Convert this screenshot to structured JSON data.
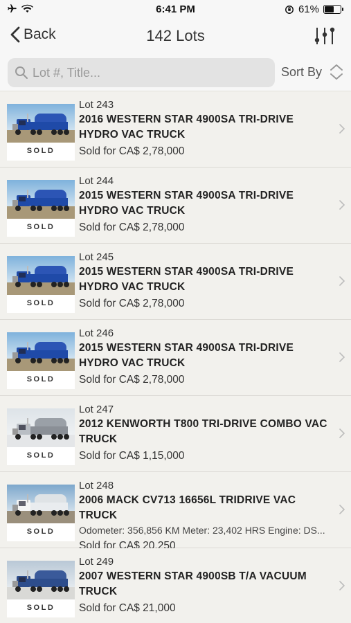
{
  "status_bar": {
    "time": "6:41 PM",
    "battery": "61%",
    "battery_level": 0.61
  },
  "nav": {
    "back_label": "Back",
    "title": "142 Lots"
  },
  "search": {
    "placeholder": "Lot #, Title...",
    "value": "",
    "sort_label": "Sort By"
  },
  "lots": [
    {
      "lot": "Lot 243",
      "title": "2016 WESTERN STAR 4900SA TRI-DRIVE HYDRO VAC TRUCK",
      "subtitle": "",
      "price": "Sold for CA$ 2,78,000",
      "status": "SOLD",
      "image": "blue-vac-truck"
    },
    {
      "lot": "Lot 244",
      "title": "2015 WESTERN STAR 4900SA TRI-DRIVE HYDRO VAC TRUCK",
      "subtitle": "",
      "price": "Sold for CA$ 2,78,000",
      "status": "SOLD",
      "image": "blue-vac-truck"
    },
    {
      "lot": "Lot 245",
      "title": "2015 WESTERN STAR 4900SA TRI-DRIVE HYDRO VAC TRUCK",
      "subtitle": "",
      "price": "Sold for CA$ 2,78,000",
      "status": "SOLD",
      "image": "blue-vac-truck"
    },
    {
      "lot": "Lot 246",
      "title": "2015 WESTERN STAR 4900SA TRI-DRIVE HYDRO VAC TRUCK",
      "subtitle": "",
      "price": "Sold for CA$ 2,78,000",
      "status": "SOLD",
      "image": "blue-vac-truck"
    },
    {
      "lot": "Lot 247",
      "title": "2012 KENWORTH T800 TRI-DRIVE COMBO VAC TRUCK",
      "subtitle": "",
      "price": "Sold for CA$ 1,15,000",
      "status": "SOLD",
      "image": "silver-combo-truck"
    },
    {
      "lot": "Lot 248",
      "title": "2006 MACK CV713 16656L TRIDRIVE VAC TRUCK",
      "subtitle": "Odometer: 356,856 KM Meter: 23,402 HRS Engine: DS...",
      "price": "Sold for CA$ 20,250",
      "status": "SOLD",
      "image": "white-tank-truck"
    },
    {
      "lot": "Lot 249",
      "title": "2007 WESTERN STAR 4900SB T/A VACUUM TRUCK",
      "subtitle": "",
      "price": "Sold for CA$ 21,000",
      "status": "SOLD",
      "image": "blue-vacuum-truck"
    }
  ]
}
